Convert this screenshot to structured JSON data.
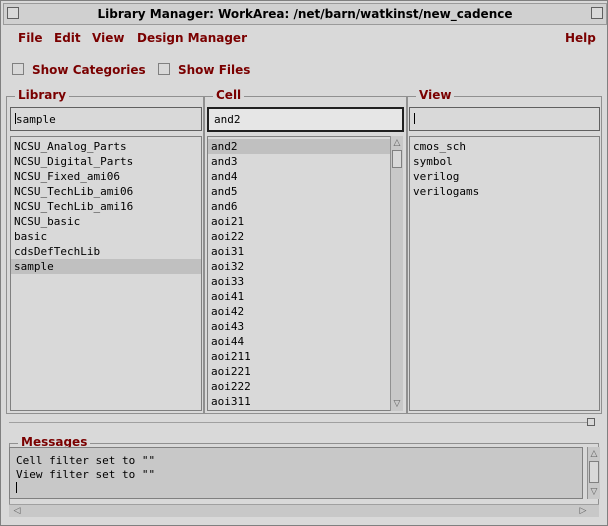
{
  "window": {
    "title": "Library Manager: WorkArea: /net/barn/watkinst/new_cadence"
  },
  "menu": {
    "file": "File",
    "edit": "Edit",
    "view": "View",
    "design_manager": "Design Manager",
    "help": "Help"
  },
  "options": {
    "show_categories": "Show Categories",
    "show_files": "Show Files"
  },
  "library": {
    "label": "Library",
    "filter": "sample",
    "items": [
      "NCSU_Analog_Parts",
      "NCSU_Digital_Parts",
      "NCSU_Fixed_ami06",
      "NCSU_TechLib_ami06",
      "NCSU_TechLib_ami16",
      "NCSU_basic",
      "basic",
      "cdsDefTechLib",
      "sample"
    ],
    "selected": "sample"
  },
  "cell": {
    "label": "Cell",
    "filter": "and2",
    "items": [
      "and2",
      "and3",
      "and4",
      "and5",
      "and6",
      "aoi21",
      "aoi22",
      "aoi31",
      "aoi32",
      "aoi33",
      "aoi41",
      "aoi42",
      "aoi43",
      "aoi44",
      "aoi211",
      "aoi221",
      "aoi222",
      "aoi311"
    ],
    "selected": "and2"
  },
  "view": {
    "label": "View",
    "filter": "",
    "items": [
      "cmos_sch",
      "symbol",
      "verilog",
      "verilogams"
    ]
  },
  "messages": {
    "label": "Messages",
    "lines": [
      "Cell filter set to \"\"",
      "View filter set to \"\""
    ]
  },
  "colors": {
    "label_red": "#7a0000",
    "background": "#d9d9d9",
    "selection": "#c0c0c0"
  }
}
